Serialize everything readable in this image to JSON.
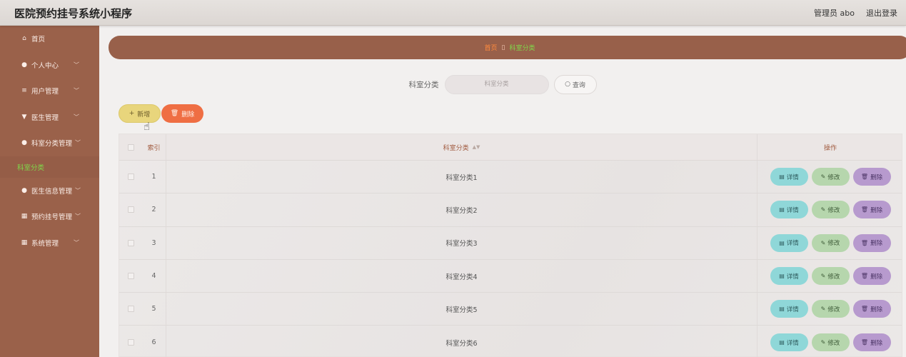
{
  "header": {
    "app_title": "医院预约挂号系统小程序",
    "admin_text": "管理员 abo",
    "logout_text": "退出登录"
  },
  "sidebar": {
    "items": [
      {
        "label": "首页",
        "icon": "home-icon"
      },
      {
        "label": "个人中心",
        "icon": "user-icon"
      },
      {
        "label": "用户管理",
        "icon": "list-icon"
      },
      {
        "label": "医生管理",
        "icon": "badge-icon"
      },
      {
        "label": "科室分类管理",
        "icon": "user-icon"
      },
      {
        "label": "医生信息管理",
        "icon": "user-icon"
      },
      {
        "label": "预约挂号管理",
        "icon": "grid-icon"
      },
      {
        "label": "系统管理",
        "icon": "grid-icon"
      }
    ],
    "active_sub": "科室分类"
  },
  "breadcrumb": {
    "home": "首页",
    "current": "科室分类"
  },
  "search": {
    "label": "科室分类",
    "placeholder": "科室分类",
    "query_label": "查询"
  },
  "actions": {
    "add_label": "新增",
    "delete_label": "删除"
  },
  "table": {
    "headers": {
      "index": "索引",
      "name": "科室分类",
      "ops": "操作"
    },
    "rows": [
      {
        "index": "1",
        "name": "科室分类1"
      },
      {
        "index": "2",
        "name": "科室分类2"
      },
      {
        "index": "3",
        "name": "科室分类3"
      },
      {
        "index": "4",
        "name": "科室分类4"
      },
      {
        "index": "5",
        "name": "科室分类5"
      },
      {
        "index": "6",
        "name": "科室分类6"
      }
    ],
    "row_actions": {
      "detail": "详情",
      "edit": "修改",
      "delete": "删除"
    }
  },
  "colors": {
    "sidebar_bg": "#9a614a",
    "breadcrumb_bg": "#98604a",
    "active_green": "#7fd84a",
    "add_button": "#e8d57c",
    "delete_button": "#ef6e43",
    "detail_button": "#8fd7d8",
    "edit_button": "#b6d6ad",
    "row_delete_button": "#b79ace"
  }
}
